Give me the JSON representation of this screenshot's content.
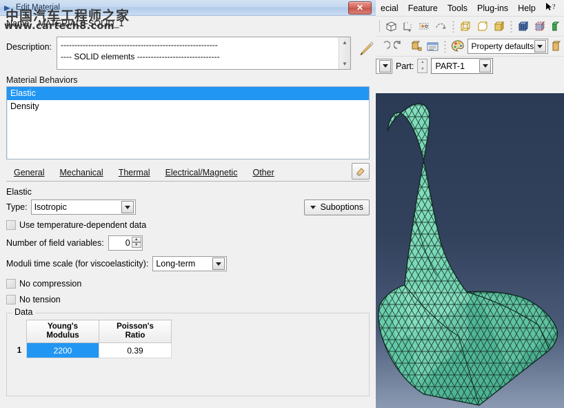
{
  "dialog": {
    "title": "Edit Material",
    "close_label": "✕",
    "name_label": "Name:",
    "name_value": "MATERIAL8-SOLID_1",
    "description_label": "Description:",
    "description_value": "---------------------------------------------------------\n---- SOLID elements ------------------------------",
    "description_edit_icon": "pencil-icon",
    "scroll_up_icon": "▲",
    "scroll_down_icon": "▼",
    "behaviors_label": "Material Behaviors",
    "behaviors": [
      {
        "label": "Elastic",
        "selected": true
      },
      {
        "label": "Density",
        "selected": false
      }
    ],
    "tabs": [
      {
        "label": "General",
        "mnemonic": "G"
      },
      {
        "label": "Mechanical",
        "mnemonic": "M"
      },
      {
        "label": "Thermal",
        "mnemonic": "T"
      },
      {
        "label": "Electrical/Magnetic",
        "mnemonic": "E"
      },
      {
        "label": "Other",
        "mnemonic": "O"
      }
    ],
    "eraser_icon": "eraser-icon",
    "section_title": "Elastic",
    "type_label": "Type:",
    "type_value": "Isotropic",
    "suboptions_label": "Suboptions",
    "temp_dependent_label": "Use temperature-dependent data",
    "temp_dependent_checked": false,
    "field_vars_label": "Number of field variables:",
    "field_vars_value": "0",
    "moduli_label": "Moduli time scale (for viscoelasticity):",
    "moduli_value": "Long-term",
    "no_compression_label": "No compression",
    "no_compression_checked": false,
    "no_tension_label": "No tension",
    "no_tension_checked": false,
    "data_legend": "Data",
    "data_table": {
      "columns": [
        "Young's\nModulus",
        "Poisson's\nRatio"
      ],
      "col1_line1": "Young's",
      "col1_line2": "Modulus",
      "col2_line1": "Poisson's",
      "col2_line2": "Ratio",
      "rows": [
        {
          "index": "1",
          "youngs_modulus": "2200",
          "poissons_ratio": "0.39",
          "selected_cell": "youngs_modulus"
        }
      ]
    },
    "accent_selection": "#2196f3",
    "titlebar_color": "#c3d8ef",
    "close_color": "#c3564c"
  },
  "watermark": {
    "line1": "中国汽车工程师之家",
    "line2": "www.cartech8.com"
  },
  "abaqus": {
    "menu": [
      {
        "label": "ecial",
        "mnemonic": "l"
      },
      {
        "label": "Feature",
        "mnemonic": "u"
      },
      {
        "label": "Tools",
        "mnemonic": "T"
      },
      {
        "label": "Plug-ins",
        "mnemonic": "g"
      },
      {
        "label": "Help",
        "mnemonic": "H"
      }
    ],
    "help_cursor_icon": "arrow-question-icon",
    "toolbar_icons": [
      "partition-cell-icon",
      "datum-plane-icon",
      "datum-point-icon",
      "sketch-icon",
      "wireframe-render-icon",
      "hidden-line-render-icon",
      "shaded-render-icon",
      "mesh-render-icon",
      "dashed-mesh-icon"
    ],
    "toolbar2_icons": [
      "undo-icon",
      "redo-icon",
      "assign-section-icon",
      "section-manager-icon",
      "color-palette-icon",
      "material-library-icon"
    ],
    "module_label": "Property defaults",
    "part_label": "Part:",
    "part_value": "PART-1",
    "viewport_bg_top": "#2b3a55",
    "viewport_bg_bottom": "#8b9ab2",
    "mesh_color": "#5fc5a4",
    "mesh_edge_color": "#1c3a30"
  }
}
